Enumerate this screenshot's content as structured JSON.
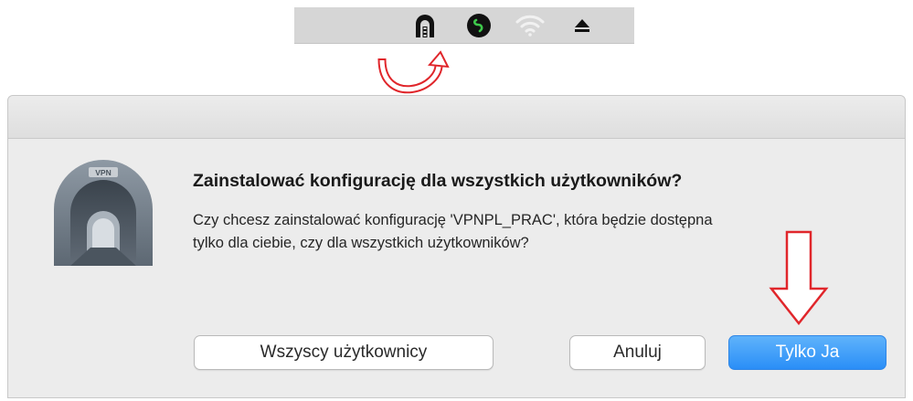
{
  "menubar": {
    "icons": [
      "vpn-tunnel-icon",
      "vpn-connected-icon",
      "wifi-icon",
      "eject-icon"
    ]
  },
  "dialog": {
    "icon_label": "VPN",
    "title": "Zainstalować konfigurację dla wszystkich użytkowników?",
    "message_line1": "Czy chcesz zainstalować konfigurację 'VPNPL_PRAC', która będzie dostępna",
    "message_line2": "tylko dla ciebie, czy dla wszystkich użytkowników?",
    "buttons": {
      "all_users": "Wszyscy użytkownicy",
      "cancel": "Anuluj",
      "only_me": "Tylko Ja"
    }
  },
  "colors": {
    "annotation": "#e0262b",
    "primary_button": "#2a8ef7",
    "dialog_background": "#ececec"
  }
}
